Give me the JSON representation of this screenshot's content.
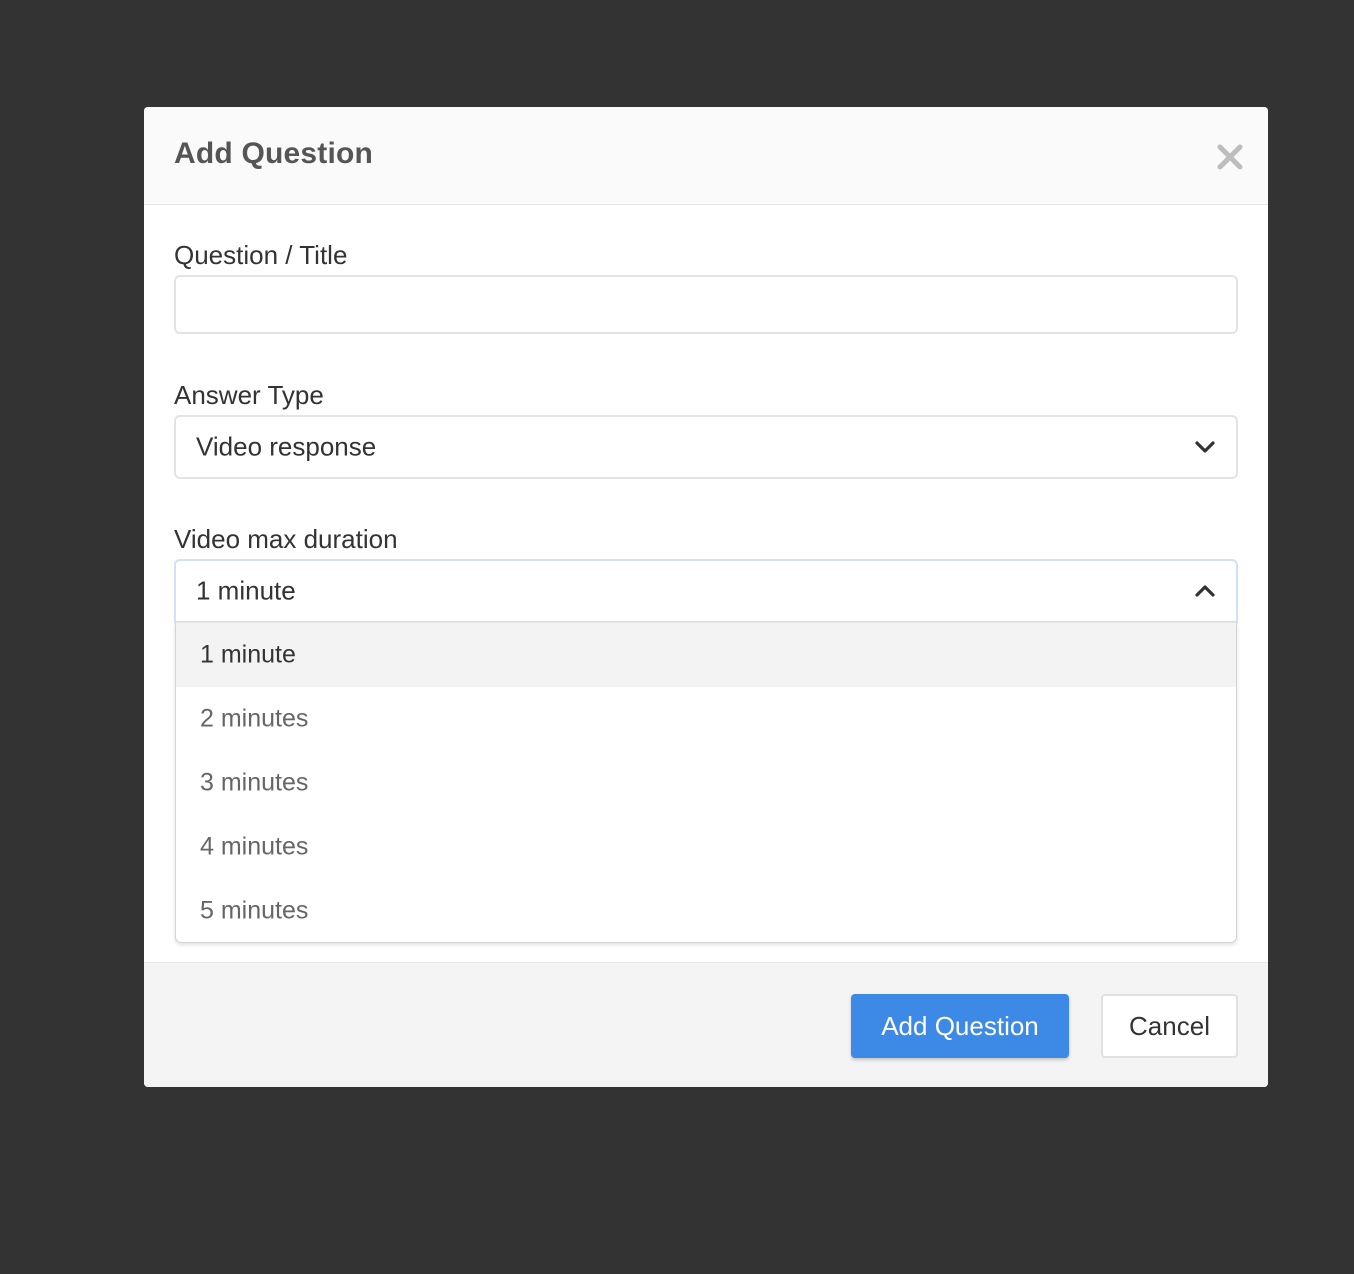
{
  "modal": {
    "title": "Add Question",
    "close_icon": "close-icon"
  },
  "fields": {
    "question": {
      "label": "Question / Title",
      "value": "",
      "placeholder": ""
    },
    "answer_type": {
      "label": "Answer Type",
      "selected": "Video response",
      "icon": "chevron-down-icon"
    },
    "video_duration": {
      "label": "Video max duration",
      "selected": "1 minute",
      "icon": "chevron-up-icon",
      "options": [
        "1 minute",
        "2 minutes",
        "3 minutes",
        "4 minutes",
        "5 minutes"
      ]
    }
  },
  "footer": {
    "submit_label": "Add Question",
    "cancel_label": "Cancel"
  },
  "colors": {
    "primary": "#3d8ae6",
    "backdrop": "#333333",
    "focus_border": "#cfe2f7"
  }
}
